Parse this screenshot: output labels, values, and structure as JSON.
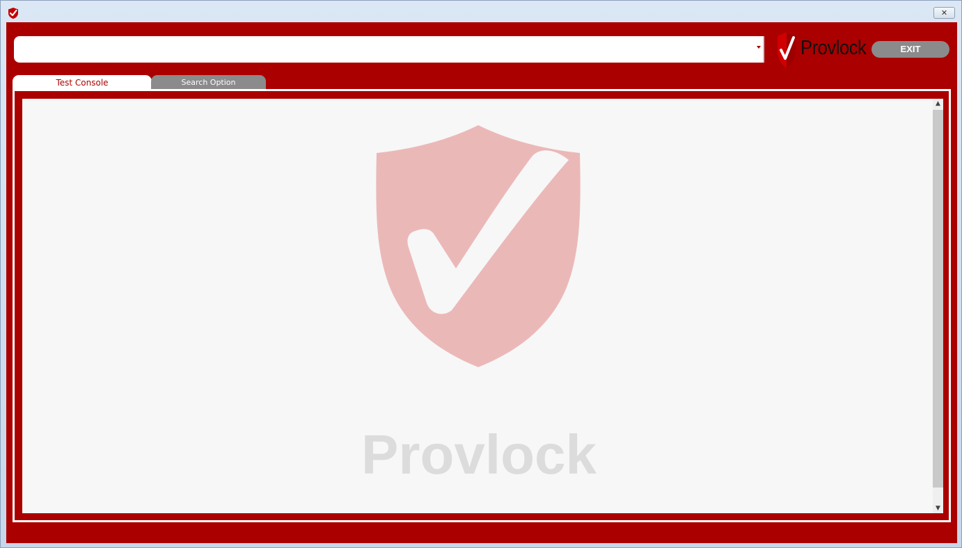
{
  "window": {
    "icon": "shield-check-icon",
    "close_icon": "close-icon",
    "close_label": "✕"
  },
  "toolbar": {
    "search_combo_value": "",
    "dropdown_icon": "chevron-down-icon",
    "logo_text": "Provlock",
    "exit_label": "EXIT"
  },
  "tabs": [
    {
      "label": "Test Console",
      "active": true
    },
    {
      "label": "Search Option",
      "active": false
    }
  ],
  "console": {
    "watermark_text": "Provlock"
  },
  "colors": {
    "brand_red": "#ab0000",
    "tab_inactive": "#8b8b8b",
    "watermark_shield": "#ebb8b8",
    "watermark_text": "#dcdcdc"
  }
}
